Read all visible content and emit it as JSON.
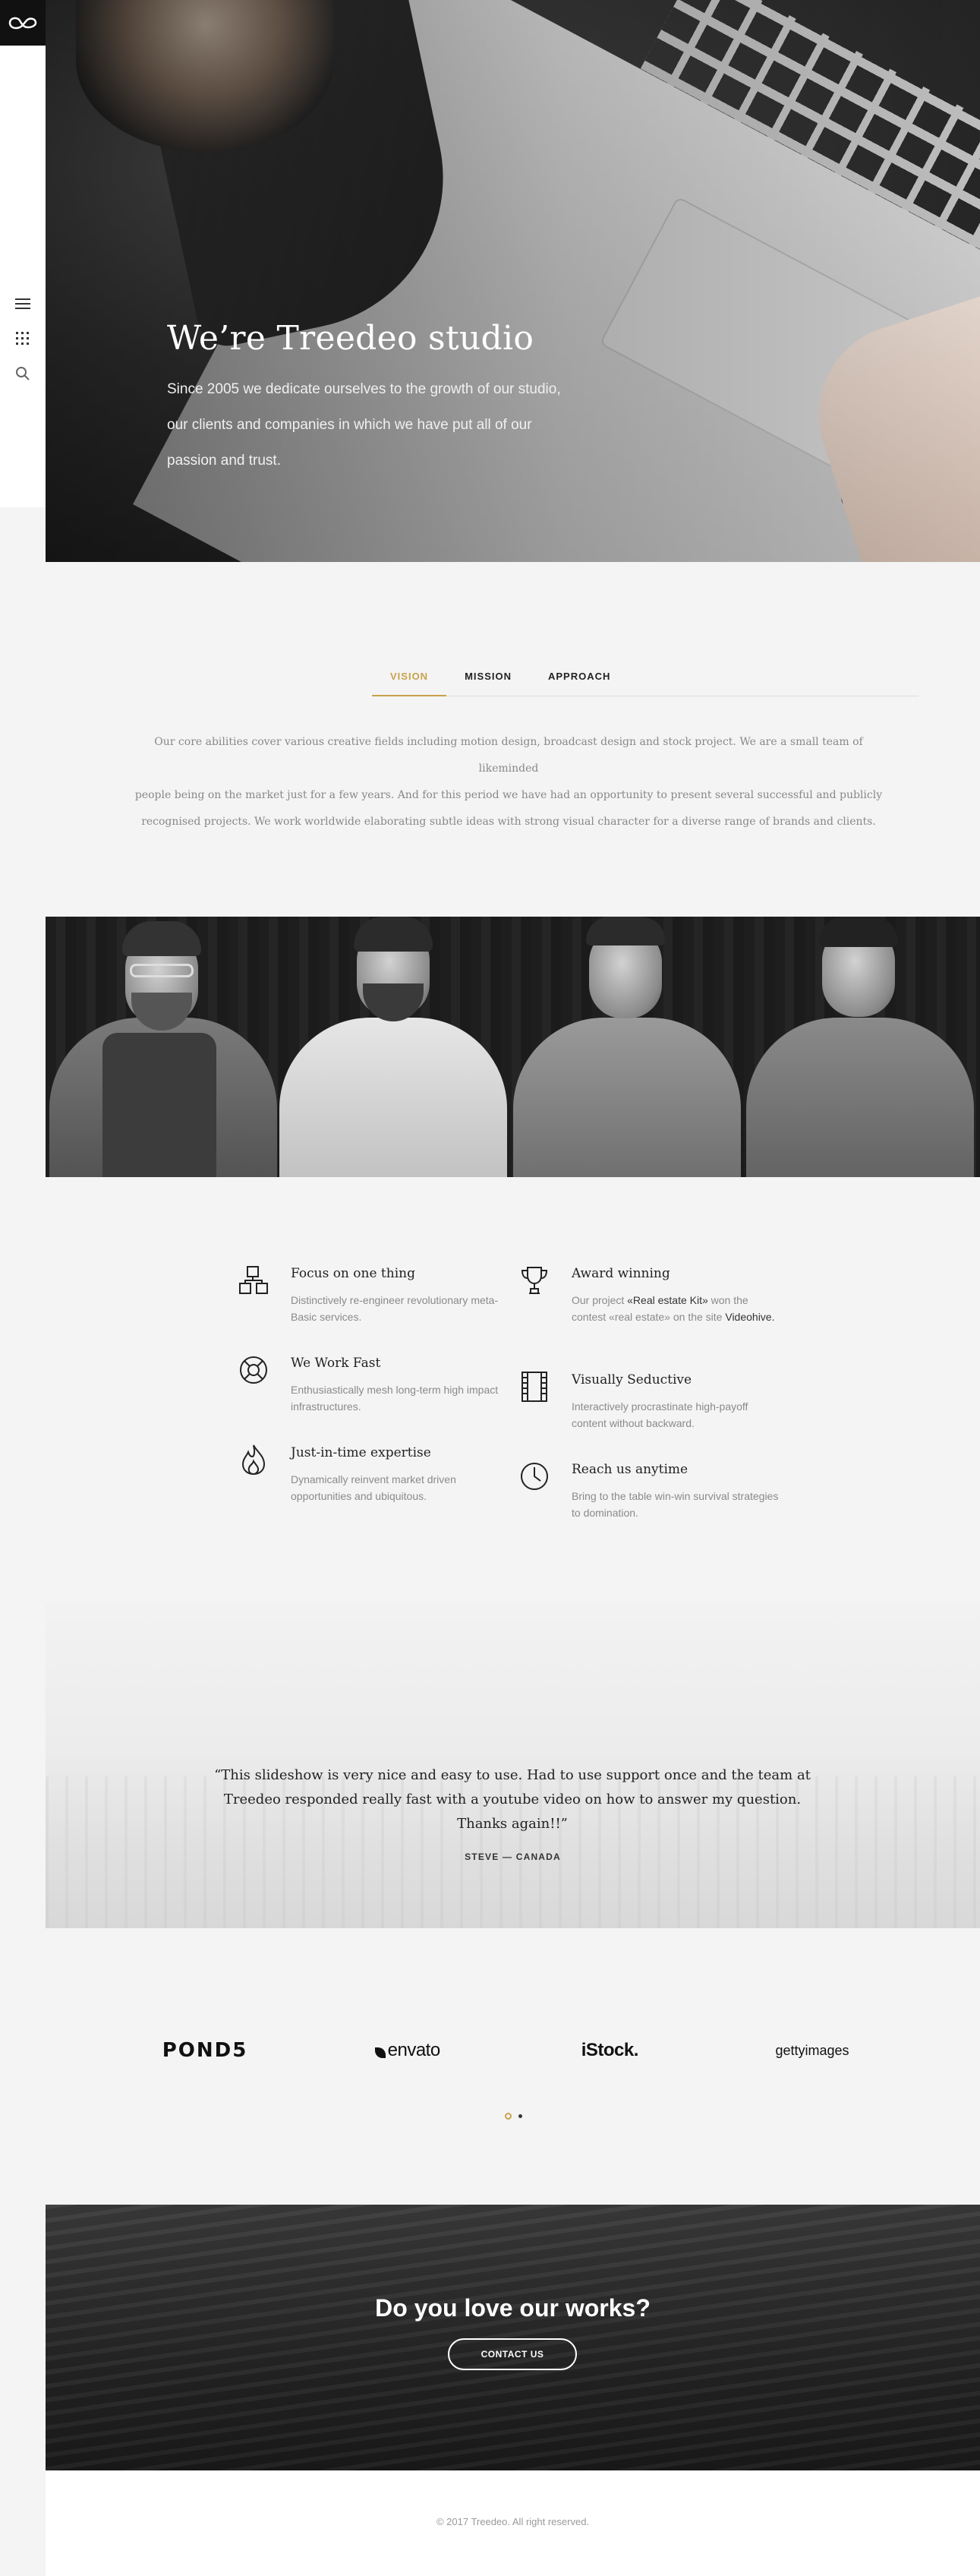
{
  "sidebar": {
    "logo": "treedeo-logo",
    "icons": [
      "menu-icon",
      "grid-icon",
      "search-icon"
    ]
  },
  "hero": {
    "title": "We’re Treedeo studio",
    "subtitle_lines": [
      "Since 2005 we dedicate ourselves to the growth of our studio,",
      "our clients and companies in which we have put all of our",
      "passion and trust."
    ]
  },
  "tabs": {
    "items": [
      "VISION",
      "MISSION",
      "APPROACH"
    ],
    "active": "VISION",
    "active_color": "#c9a24a"
  },
  "about": {
    "lines": [
      "Our core abilities cover various creative fields including motion design, broadcast design and stock project. We are a small team of likeminded",
      "people being on the market just for a few years. And for this period we have had an opportunity to present several successful and publicly",
      "recognised projects. We work worldwide elaborating subtle ideas with strong visual character for a diverse range of brands and clients."
    ]
  },
  "features": [
    {
      "icon": "boxes-icon",
      "title": "Focus on one thing",
      "desc": "Distinctively re-engineer revolutionary meta-Basic services."
    },
    {
      "icon": "lifebuoy-icon",
      "title": "We Work Fast",
      "desc": "Enthusiastically mesh long-term high impact infrastructures."
    },
    {
      "icon": "flame-icon",
      "title": "Just-in-time expertise",
      "desc": "Dynamically reinvent market driven opportunities and ubiquitous."
    },
    {
      "icon": "trophy-icon",
      "title": "Award winning",
      "desc_parts": [
        "Our project ",
        "«Real estate Kit»",
        " won the contest «real estate» on the site ",
        "Videohive."
      ]
    },
    {
      "icon": "film-icon",
      "title": "Visually Seductive",
      "desc": "Interactively procrastinate high-payoff content without backward."
    },
    {
      "icon": "clock-icon",
      "title": "Reach us anytime",
      "desc": "Bring to the table win-win survival strategies to domination."
    }
  ],
  "testimonial": {
    "quote_lines": [
      "“This slideshow is very nice and easy to use. Had to use support once and the team at",
      "Treedeo responded really fast with a youtube video on how to answer my question.",
      "Thanks again!!”"
    ],
    "author": "STEVE — CANADA"
  },
  "partners": [
    "POND5",
    "envato",
    "iStock.",
    "gettyimages"
  ],
  "carousel": {
    "pages": 2,
    "active": 1
  },
  "cta": {
    "title": "Do you love our works?",
    "button": "CONTACT US"
  },
  "footer": {
    "copyright": "© 2017 Treedeo. All right reserved."
  }
}
